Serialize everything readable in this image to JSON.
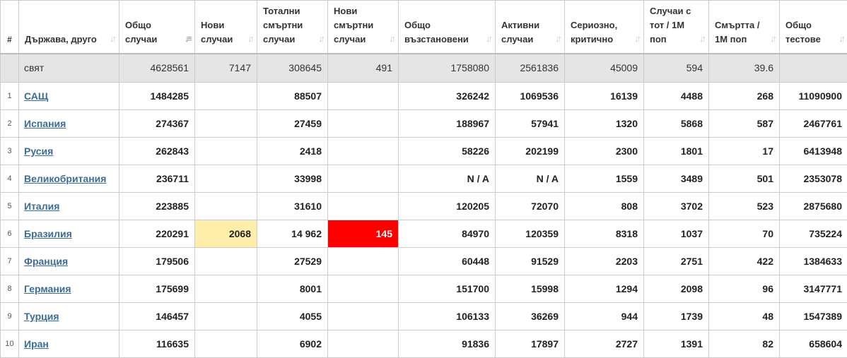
{
  "table": {
    "headers": [
      {
        "key": "idx",
        "label": "#",
        "sortable": false
      },
      {
        "key": "country",
        "label": "Държава, друго",
        "sortable": true,
        "active": false
      },
      {
        "key": "total_cases",
        "label": "Общо случаи",
        "sortable": true,
        "active": true
      },
      {
        "key": "new_cases",
        "label": "Нови случаи",
        "sortable": true,
        "active": false
      },
      {
        "key": "total_deaths",
        "label": "Тотални смъртни случаи",
        "sortable": true,
        "active": false
      },
      {
        "key": "new_deaths",
        "label": "Нови смъртни случаи",
        "sortable": true,
        "active": false
      },
      {
        "key": "total_recovered",
        "label": "Общо възстановени",
        "sortable": true,
        "active": false
      },
      {
        "key": "active_cases",
        "label": "Активни случаи",
        "sortable": true,
        "active": false
      },
      {
        "key": "critical",
        "label": "Сериозно, критично",
        "sortable": true,
        "active": false
      },
      {
        "key": "cases_per_1m",
        "label": "Случаи с тот / 1М поп",
        "sortable": true,
        "active": false
      },
      {
        "key": "deaths_per_1m",
        "label": "Смъртта / 1М поп",
        "sortable": true,
        "active": false
      },
      {
        "key": "total_tests",
        "label": "Общо тестове",
        "sortable": true,
        "active": false
      }
    ],
    "world": {
      "idx": "",
      "country": "свят",
      "total_cases": "4628561",
      "new_cases": "7147",
      "total_deaths": "308645",
      "new_deaths": "491",
      "total_recovered": "1758080",
      "active_cases": "2561836",
      "critical": "45009",
      "cases_per_1m": "594",
      "deaths_per_1m": "39.6",
      "total_tests": ""
    },
    "rows": [
      {
        "idx": "1",
        "country": "САЩ",
        "total_cases": "1484285",
        "new_cases": "",
        "total_deaths": "88507",
        "new_deaths": "",
        "total_recovered": "326242",
        "active_cases": "1069536",
        "critical": "16139",
        "cases_per_1m": "4488",
        "deaths_per_1m": "268",
        "total_tests": "11090900"
      },
      {
        "idx": "2",
        "country": "Испания",
        "total_cases": "274367",
        "new_cases": "",
        "total_deaths": "27459",
        "new_deaths": "",
        "total_recovered": "188967",
        "active_cases": "57941",
        "critical": "1320",
        "cases_per_1m": "5868",
        "deaths_per_1m": "587",
        "total_tests": "2467761"
      },
      {
        "idx": "3",
        "country": "Русия",
        "total_cases": "262843",
        "new_cases": "",
        "total_deaths": "2418",
        "new_deaths": "",
        "total_recovered": "58226",
        "active_cases": "202199",
        "critical": "2300",
        "cases_per_1m": "1801",
        "deaths_per_1m": "17",
        "total_tests": "6413948"
      },
      {
        "idx": "4",
        "country": "Великобритания",
        "total_cases": "236711",
        "new_cases": "",
        "total_deaths": "33998",
        "new_deaths": "",
        "total_recovered": "N / A",
        "active_cases": "N / A",
        "critical": "1559",
        "cases_per_1m": "3489",
        "deaths_per_1m": "501",
        "total_tests": "2353078"
      },
      {
        "idx": "5",
        "country": "Италия",
        "total_cases": "223885",
        "new_cases": "",
        "total_deaths": "31610",
        "new_deaths": "",
        "total_recovered": "120205",
        "active_cases": "72070",
        "critical": "808",
        "cases_per_1m": "3702",
        "deaths_per_1m": "523",
        "total_tests": "2875680"
      },
      {
        "idx": "6",
        "country": "Бразилия",
        "total_cases": "220291",
        "new_cases": "2068",
        "total_deaths": "14 962",
        "new_deaths": "145",
        "total_recovered": "84970",
        "active_cases": "120359",
        "critical": "8318",
        "cases_per_1m": "1037",
        "deaths_per_1m": "70",
        "total_tests": "735224"
      },
      {
        "idx": "7",
        "country": "Франция",
        "total_cases": "179506",
        "new_cases": "",
        "total_deaths": "27529",
        "new_deaths": "",
        "total_recovered": "60448",
        "active_cases": "91529",
        "critical": "2203",
        "cases_per_1m": "2751",
        "deaths_per_1m": "422",
        "total_tests": "1384633"
      },
      {
        "idx": "8",
        "country": "Германия",
        "total_cases": "175699",
        "new_cases": "",
        "total_deaths": "8001",
        "new_deaths": "",
        "total_recovered": "151700",
        "active_cases": "15998",
        "critical": "1294",
        "cases_per_1m": "2098",
        "deaths_per_1m": "96",
        "total_tests": "3147771"
      },
      {
        "idx": "9",
        "country": "Турция",
        "total_cases": "146457",
        "new_cases": "",
        "total_deaths": "4055",
        "new_deaths": "",
        "total_recovered": "106133",
        "active_cases": "36269",
        "critical": "944",
        "cases_per_1m": "1739",
        "deaths_per_1m": "48",
        "total_tests": "1547389"
      },
      {
        "idx": "10",
        "country": "Иран",
        "total_cases": "116635",
        "new_cases": "",
        "total_deaths": "6902",
        "new_deaths": "",
        "total_recovered": "91836",
        "active_cases": "17897",
        "critical": "2727",
        "cases_per_1m": "1391",
        "deaths_per_1m": "82",
        "total_tests": "658604"
      }
    ]
  },
  "colors": {
    "link": "#3a6d99",
    "world_row_bg": "#e5e5e5",
    "new_cases_highlight": "#ffeeaa",
    "new_deaths_highlight": "#ff0000",
    "border": "#cccccc"
  },
  "icons": {
    "sort": "sort-icon"
  }
}
